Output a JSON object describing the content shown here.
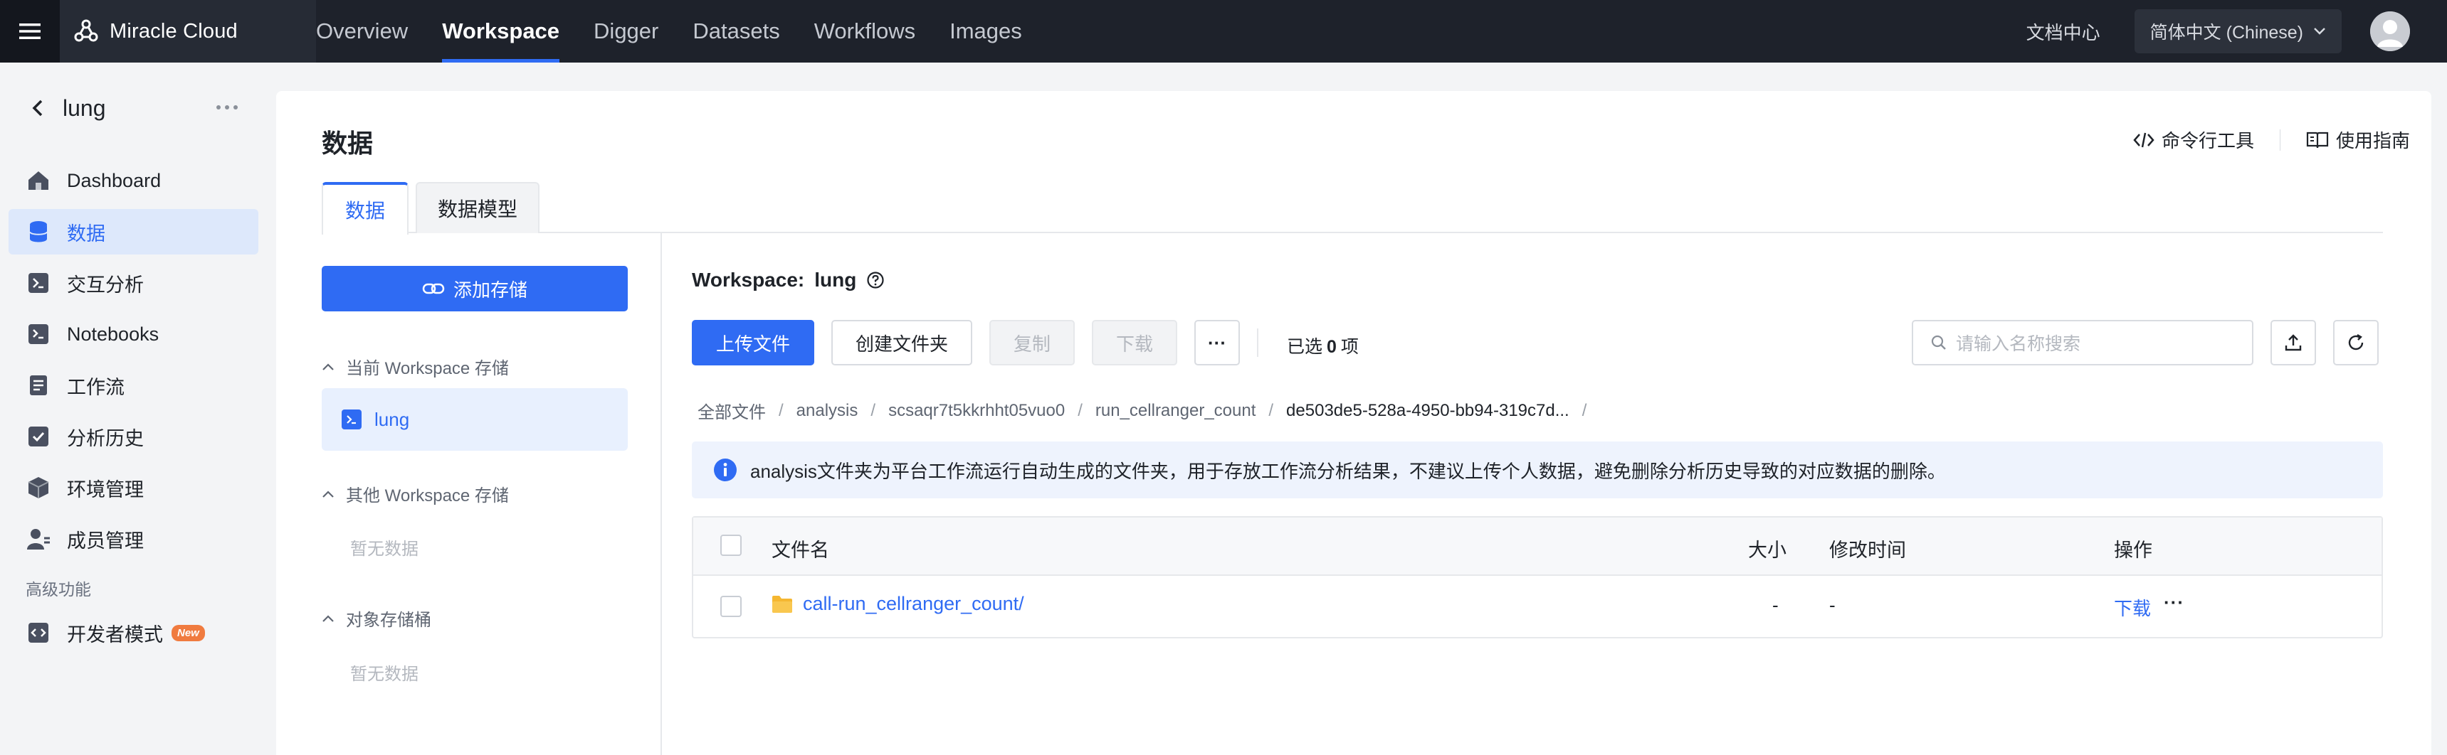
{
  "app": {
    "brand": "Miracle Cloud",
    "nav_tabs": [
      "Overview",
      "Workspace",
      "Digger",
      "Datasets",
      "Workflows",
      "Images"
    ],
    "active_tab": "Workspace",
    "doc_center": "文档中心",
    "language": "简体中文 (Chinese)",
    "accent": "#2f6bf3"
  },
  "sidebar": {
    "title": "lung",
    "items": [
      {
        "label": "Dashboard",
        "icon": "home-icon"
      },
      {
        "label": "数据",
        "icon": "database-icon"
      },
      {
        "label": "交互分析",
        "icon": "terminal-icon"
      },
      {
        "label": "Notebooks",
        "icon": "notebook-icon"
      },
      {
        "label": "工作流",
        "icon": "workflow-icon"
      },
      {
        "label": "分析历史",
        "icon": "history-icon"
      },
      {
        "label": "环境管理",
        "icon": "cube-icon"
      },
      {
        "label": "成员管理",
        "icon": "members-icon"
      }
    ],
    "section_label": "高级功能",
    "dev_mode": {
      "label": "开发者模式",
      "badge": "New"
    }
  },
  "main": {
    "title": "数据",
    "tools": {
      "cli": "命令行工具",
      "guide": "使用指南"
    },
    "tabs": [
      "数据",
      "数据模型"
    ],
    "storage": {
      "add_button": "添加存储",
      "groups": [
        {
          "label": "当前 Workspace 存储",
          "items": [
            "lung"
          ]
        },
        {
          "label": "其他 Workspace 存储",
          "empty": "暂无数据"
        },
        {
          "label": "对象存储桶",
          "empty": "暂无数据"
        }
      ]
    },
    "workspace_label": "Workspace:",
    "workspace_name": "lung",
    "actions": {
      "upload": "上传文件",
      "create_folder": "创建文件夹",
      "copy": "复制",
      "download": "下载",
      "more": "···",
      "selected_prefix": "已选",
      "selected_count": "0",
      "selected_suffix": "项"
    },
    "search_placeholder": "请输入名称搜索",
    "breadcrumb": [
      "全部文件",
      "analysis",
      "scsaqr7t5kkrhht05vuo0",
      "run_cellranger_count",
      "de503de5-528a-4950-bb94-319c7d..."
    ],
    "notice": "analysis文件夹为平台工作流运行自动生成的文件夹，用于存放工作流分析结果，不建议上传个人数据，避免删除分析历史导致的对应数据的删除。",
    "table": {
      "columns": {
        "name": "文件名",
        "size": "大小",
        "modified": "修改时间",
        "ops": "操作"
      },
      "rows": [
        {
          "name": "call-run_cellranger_count/",
          "size": "-",
          "modified": "-",
          "op": "下载",
          "more": "···"
        }
      ]
    }
  }
}
